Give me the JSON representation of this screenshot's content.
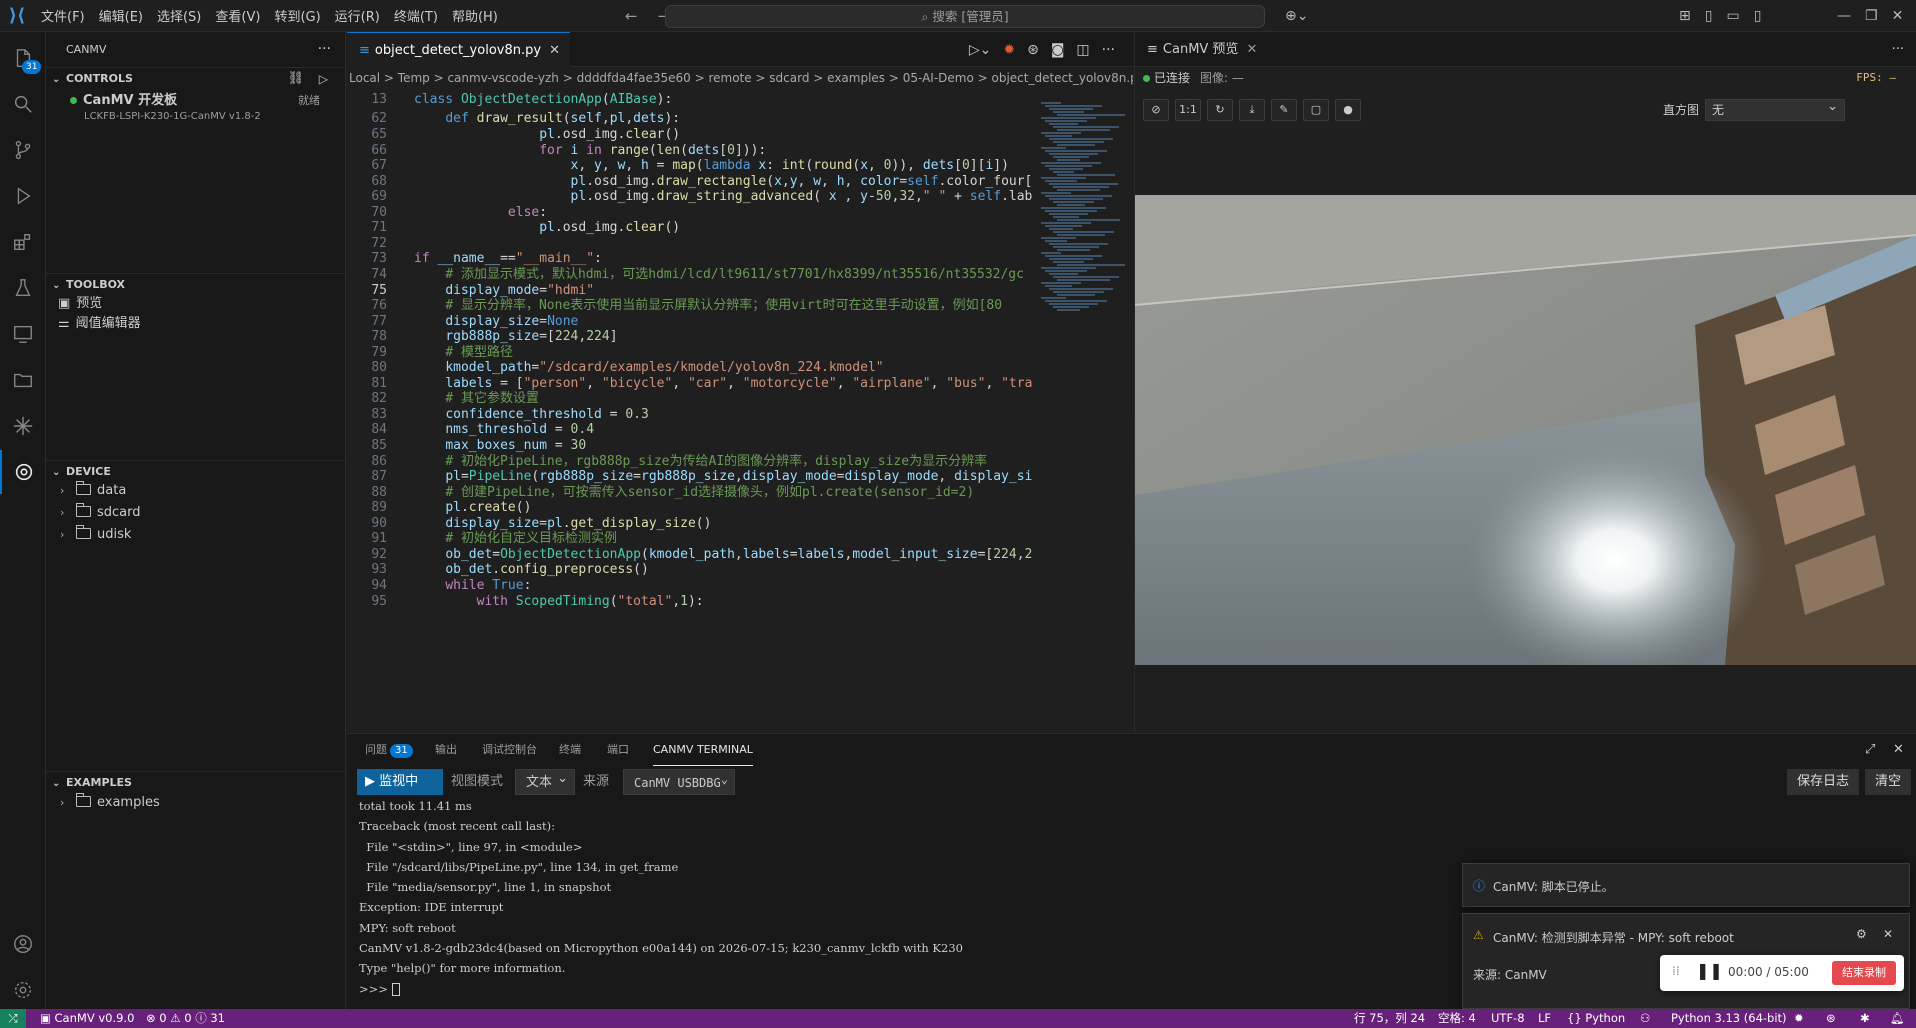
{
  "menu": [
    "文件(F)",
    "编辑(E)",
    "选择(S)",
    "查看(V)",
    "转到(G)",
    "运行(R)",
    "终端(T)",
    "帮助(H)"
  ],
  "search_text": "搜索 [管理员]",
  "activity_badge": "31",
  "sidebar": {
    "title": "CANMV",
    "controls_label": "CONTROLS",
    "board_name": "CanMV 开发板",
    "board_id": "LCKFB-LSPI-K230-1G-CanMV v1.8-2",
    "board_status": "就绪",
    "toolbox_label": "TOOLBOX",
    "toolbox_items": [
      "预览",
      "阈值编辑器"
    ],
    "device_label": "DEVICE",
    "device_items": [
      "data",
      "sdcard",
      "udisk"
    ],
    "examples_label": "EXAMPLES",
    "examples_items": [
      "examples"
    ]
  },
  "editor": {
    "tab": "object_detect_yolov8n.py",
    "breadcrumb": "Local  >  Temp  >  canmv-vscode-yzh  >  ddddfda4fae35e60  >  remote  >  sdcard  >  examples  >  05-AI-Demo  >  object_detect_yolov8n.py  >"
  },
  "preview": {
    "tab": "CanMV 预览",
    "connected": "已连接",
    "image_label": "图像: —",
    "fps": "FPS: —",
    "hist_label": "直方图",
    "hist_value": "无",
    "toolbar_buttons": [
      "⊘",
      "1:1",
      "↻",
      "⤓",
      "✎",
      "▢",
      "●"
    ]
  },
  "panel": {
    "tabs": [
      "问题",
      "输出",
      "调试控制台",
      "终端",
      "端口",
      "CANMV TERMINAL"
    ],
    "problems_count": "31",
    "monitor_btn": "监视中",
    "view_mode": "视图模式",
    "text_sel": "文本",
    "source_label": "来源",
    "source_sel": "CanMV  USBDBG",
    "save_log": "保存日志",
    "clear": "清空",
    "terminal_lines": [
      "total took 11.41 ms",
      "Traceback (most recent call last):",
      "  File \"<stdin>\", line 97, in <module>",
      "  File \"/sdcard/libs/PipeLine.py\", line 134, in get_frame",
      "  File \"media/sensor.py\", line 1, in snapshot",
      "Exception: IDE interrupt",
      "MPY: soft reboot",
      "CanMV v1.8-2-gdb23dc4(based on Micropython e00a144) on 2026-07-15; k230_canmv_lckfb with K230",
      "Type \"help()\" for more information.",
      ">>> "
    ]
  },
  "toasts": {
    "stopped": "CanMV: 脚本已停止。",
    "exception": "CanMV: 检测到脚本异常 - MPY: soft reboot",
    "source": "来源: CanMV",
    "timer": "00:00 / 05:00",
    "stop_rec": "结束录制"
  },
  "status": {
    "left1": "CanMV v0.9.0",
    "left2": "⊗ 0 ⚠ 0 ⓘ 31",
    "pos": "行 75，列 24",
    "spaces": "空格: 4",
    "enc": "UTF-8",
    "eol": "LF",
    "lang": "{} Python",
    "interp": "Python 3.13 (64-bit)"
  },
  "colors": {
    "accent": "#0078d4",
    "statusbar": "#68217a",
    "record": "#e5484d"
  }
}
